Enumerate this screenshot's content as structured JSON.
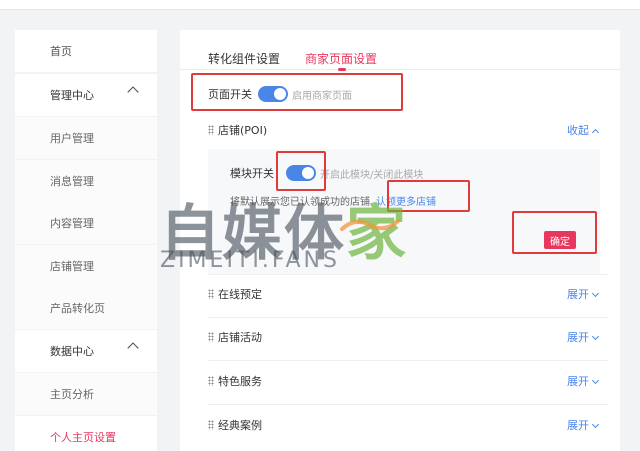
{
  "sidebar": {
    "items": [
      {
        "label": "首页"
      },
      {
        "label": "管理中心"
      },
      {
        "label": "用户管理"
      },
      {
        "label": "消息管理"
      },
      {
        "label": "内容管理"
      },
      {
        "label": "店铺管理"
      },
      {
        "label": "产品转化页"
      },
      {
        "label": "数据中心"
      },
      {
        "label": "主页分析"
      },
      {
        "label": "个人主页设置"
      }
    ]
  },
  "tabs": [
    {
      "label": "转化组件设置"
    },
    {
      "label": "商家页面设置"
    }
  ],
  "page_switch": {
    "label": "页面开关",
    "hint": "启用商家页面",
    "on": true
  },
  "sections": {
    "poi": {
      "title": "店铺(POI)",
      "action": "收起"
    },
    "booking": {
      "title": "在线预定",
      "action": "展开"
    },
    "activity": {
      "title": "店铺活动",
      "action": "展开"
    },
    "service": {
      "title": "特色服务",
      "action": "展开"
    },
    "cases": {
      "title": "经典案例",
      "action": "展开"
    }
  },
  "poi_panel": {
    "module_label": "模块开关",
    "module_hint": "开启此模块/关闭此模块",
    "module_on": true,
    "default_text": "将默认展示您已认领成功的店铺",
    "link_text": "认领更多店铺",
    "confirm_label": "确定"
  },
  "watermark": {
    "cn_part1": "自媒体",
    "cn_part2": "家",
    "en": "ZIMEITI.FANS"
  },
  "colors": {
    "accent": "#e8375f",
    "link": "#4a86e8",
    "annotation": "#e03b3b"
  }
}
